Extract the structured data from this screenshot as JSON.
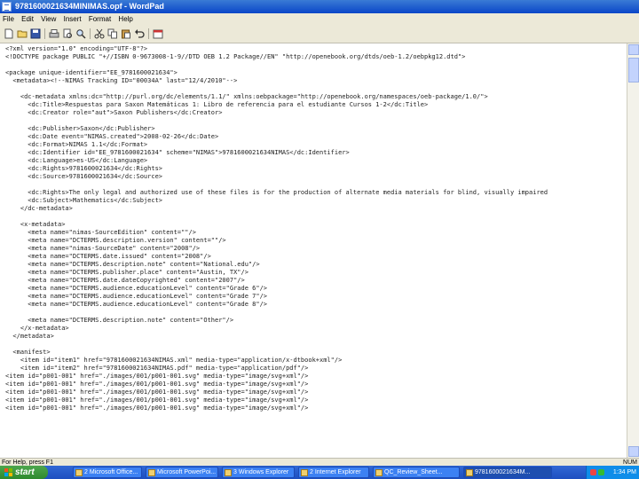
{
  "window": {
    "title": "9781600021634MINIMAS.opf - WordPad"
  },
  "menu": [
    "File",
    "Edit",
    "View",
    "Insert",
    "Format",
    "Help"
  ],
  "toolbar": {
    "icons": [
      "new-icon",
      "open-icon",
      "save-icon",
      "print-icon",
      "print-preview-icon",
      "find-icon",
      "cut-icon",
      "copy-icon",
      "paste-icon",
      "undo-icon",
      "date-time-icon"
    ]
  },
  "document": {
    "lines": [
      "<?xml version=\"1.0\" encoding=\"UTF-8\"?>",
      "<!DOCTYPE package PUBLIC \"+//ISBN 0-9673008-1-9//DTD OEB 1.2 Package//EN\" \"http://openebook.org/dtds/oeb-1.2/oebpkg12.dtd\">",
      "",
      "<package unique-identifier=\"EE_9781600021634\">",
      "  <metadata><!--NIMAS Tracking ID=\"00034A\" last=\"12/4/2010\"-->",
      "",
      "    <dc-metadata xmlns:dc=\"http://purl.org/dc/elements/1.1/\" xmlns:oebpackage=\"http://openebook.org/namespaces/oeb-package/1.0/\">",
      "      <dc:Title>Respuestas para Saxon Matemáticas 1: Libro de referencia para el estudiante Cursos 1-2</dc:Title>",
      "      <dc:Creator role=\"aut\">Saxon Publishers</dc:Creator>",
      "",
      "      <dc:Publisher>Saxon</dc:Publisher>",
      "      <dc:Date event=\"NIMAS.created\">2008-02-26</dc:Date>",
      "      <dc:Format>NIMAS 1.1</dc:Format>",
      "      <dc:Identifier id=\"EE_9781600021634\" scheme=\"NIMAS\">9781600021634NIMAS</dc:Identifier>",
      "      <dc:Language>es-US</dc:Language>",
      "      <dc:Rights>9781600021634</dc:Rights>",
      "      <dc:Source>9781600021634</dc:Source>",
      "",
      "      <dc:Rights>The only legal and authorized use of these files is for the production of alternate media materials for blind, visually impaired",
      "      <dc:Subject>Mathematics</dc:Subject>",
      "    </dc-metadata>",
      "",
      "    <x-metadata>",
      "      <meta name=\"nimas-SourceEdition\" content=\"\"/>",
      "      <meta name=\"DCTERMS.description.version\" content=\"\"/>",
      "      <meta name=\"nimas-SourceDate\" content=\"2008\"/>",
      "      <meta name=\"DCTERMS.date.issued\" content=\"2008\"/>",
      "      <meta name=\"DCTERMS.description.note\" content=\"National.edu\"/>",
      "      <meta name=\"DCTERMS.publisher.place\" content=\"Austin, TX\"/>",
      "      <meta name=\"DCTERMS.date.dateCopyrighted\" content=\"2007\"/>",
      "      <meta name=\"DCTERMS.audience.educationLevel\" content=\"Grade 6\"/>",
      "      <meta name=\"DCTERMS.audience.educationLevel\" content=\"Grade 7\"/>",
      "      <meta name=\"DCTERMS.audience.educationLevel\" content=\"Grade 8\"/>",
      "",
      "      <meta name=\"DCTERMS.description.note\" content=\"Other\"/>",
      "    </x-metadata>",
      "  </metadata>",
      "",
      "  <manifest>",
      "    <item id=\"item1\" href=\"9781600021634NIMAS.xml\" media-type=\"application/x-dtbook+xml\"/>",
      "    <item id=\"item2\" href=\"9781600021634NIMAS.pdf\" media-type=\"application/pdf\"/>",
      "<item id=\"p001-001\" href=\"./images/001/p001-001.svg\" media-type=\"image/svg+xml\"/>",
      "<item id=\"p001-001\" href=\"./images/001/p001-001.svg\" media-type=\"image/svg+xml\"/>",
      "<item id=\"p001-001\" href=\"./images/001/p001-001.svg\" media-type=\"image/svg+xml\"/>",
      "<item id=\"p001-001\" href=\"./images/001/p001-001.svg\" media-type=\"image/svg+xml\"/>",
      "<item id=\"p001-001\" href=\"./images/001/p001-001.svg\" media-type=\"image/svg+xml\"/>"
    ]
  },
  "status": {
    "help": "For Help, press F1",
    "num": "NUM"
  },
  "taskbar": {
    "start_label": "start",
    "tasks": [
      "2 Microsoft Office...",
      "Microsoft PowerPoi...",
      "3 Windows Explorer",
      "2 Internet Explorer",
      "QC_Review_Sheet...",
      "9781600021634M..."
    ],
    "clock": "1:34 PM"
  },
  "colors": {
    "titlebar": "#0a46c8",
    "taskbar": "#1d4fc0",
    "start": "#2e8a2e"
  }
}
